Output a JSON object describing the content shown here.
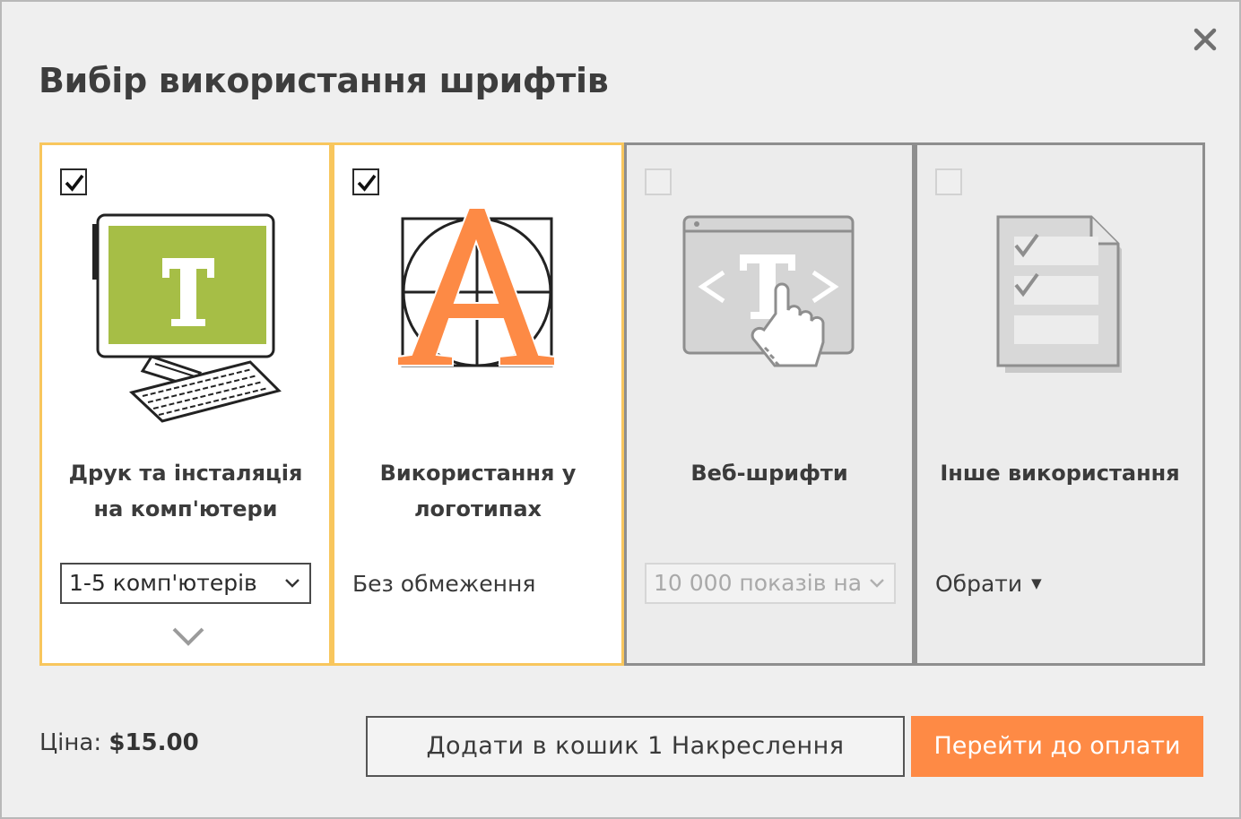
{
  "dialog": {
    "title": "Вибір використання шрифтів",
    "close_icon": "close-icon"
  },
  "cards": [
    {
      "id": "print",
      "selected": true,
      "checked": true,
      "icon": "computer-monitor-icon",
      "label_line1": "Друк та інсталяція",
      "label_line2": "на комп'ютери",
      "select_value": "1-5 комп'ютерів",
      "expand_icon": "chevron-down-icon"
    },
    {
      "id": "logo",
      "selected": true,
      "checked": true,
      "icon": "logo-letter-a-icon",
      "label_line1": "Використання у",
      "label_line2": "логотипах",
      "value": "Без обмеження"
    },
    {
      "id": "web",
      "selected": false,
      "checked": false,
      "icon": "web-browser-icon",
      "label_line1": "Веб-шрифти",
      "select_value": "10 000 показів на"
    },
    {
      "id": "other",
      "selected": false,
      "checked": false,
      "icon": "checklist-document-icon",
      "label_line1": "Інше використання",
      "dropdown_label": "Обрати"
    }
  ],
  "footer": {
    "price_label": "Ціна:",
    "price_value": "$15.00",
    "add_to_cart_label": "Додати в кошик 1 Накреслення",
    "checkout_label": "Перейти до оплати"
  },
  "colors": {
    "accent_orange": "#fe8a45",
    "selected_border": "#f8c65d",
    "monitor_green": "#a6be46",
    "logo_orange": "#fd8a45"
  }
}
